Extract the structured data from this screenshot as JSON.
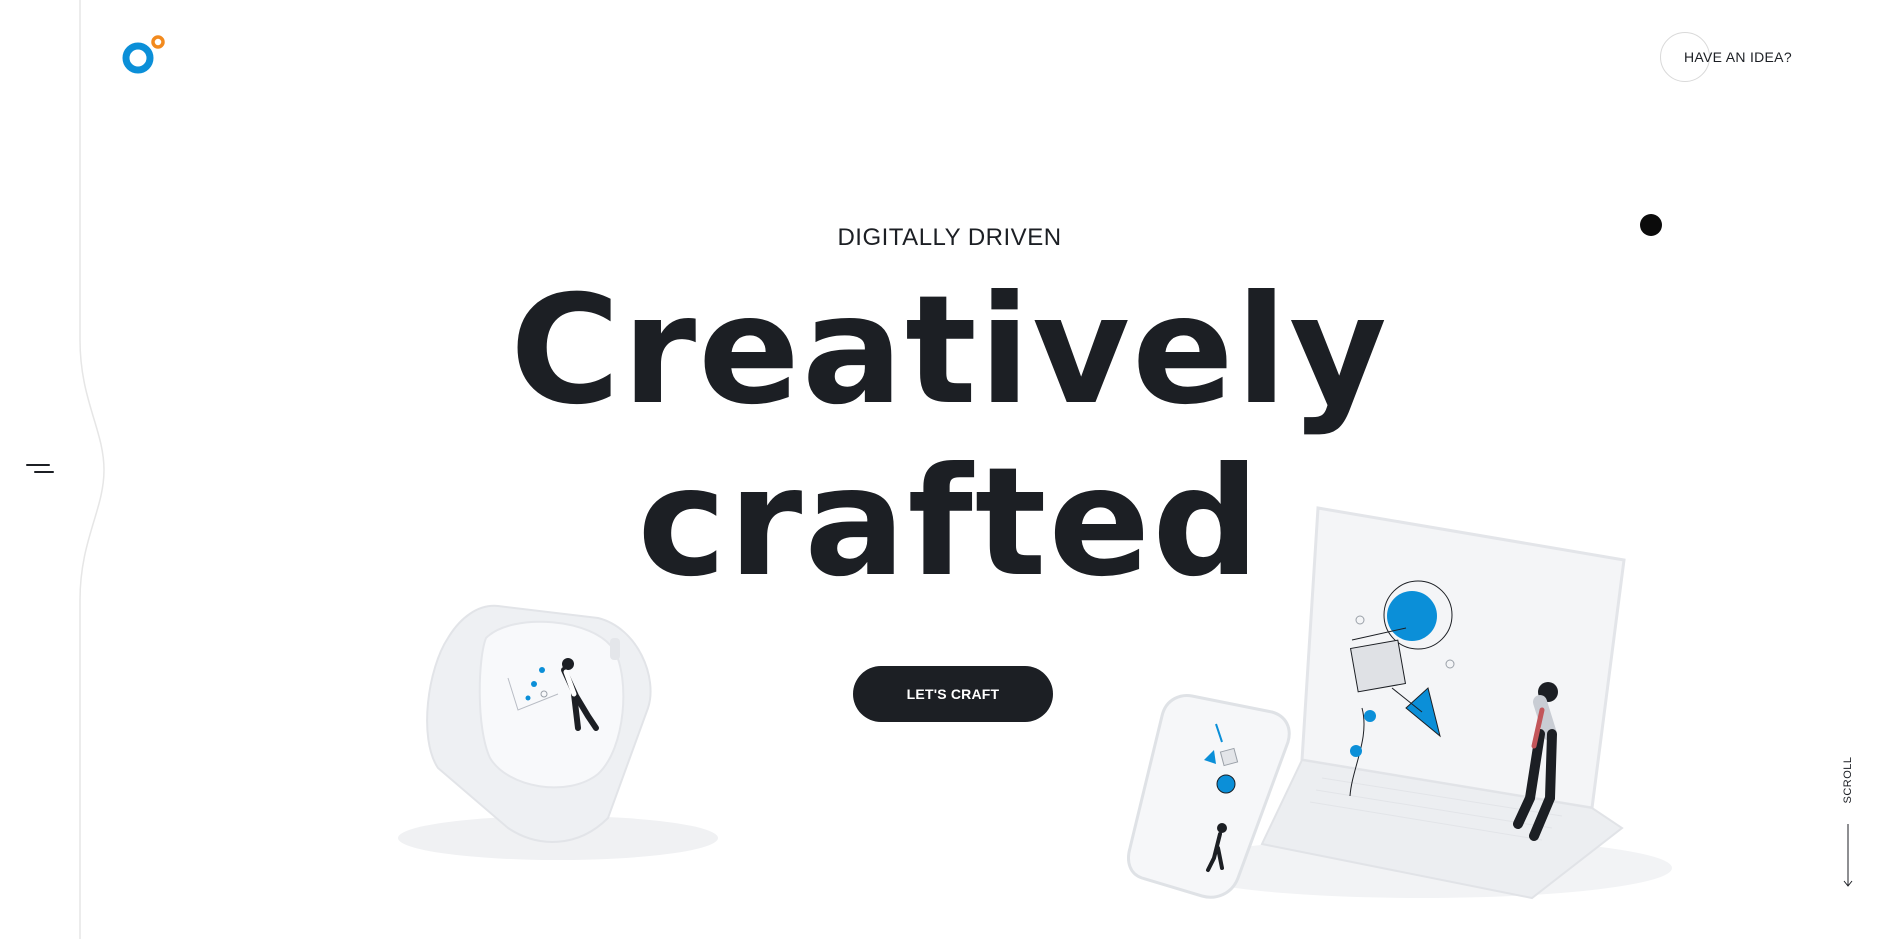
{
  "brand": {
    "accent": "#0b8fd8",
    "accent_secondary": "#f28a1e",
    "ink": "#1c1f24"
  },
  "header": {
    "logo_icon": "rings-logo-icon",
    "cta_label": "HAVE AN IDEA?"
  },
  "nav": {
    "menu_icon": "hamburger-icon"
  },
  "hero": {
    "eyebrow": "DIGITALLY DRIVEN",
    "headline_line1": "Creatively",
    "headline_line2": "crafted",
    "button_label": "LET'S CRAFT"
  },
  "scroll": {
    "label": "SCROLL",
    "icon": "arrow-down-icon"
  },
  "illustrations": {
    "watch": "smartwatch-illustration",
    "devices": "laptop-phone-illustration"
  }
}
